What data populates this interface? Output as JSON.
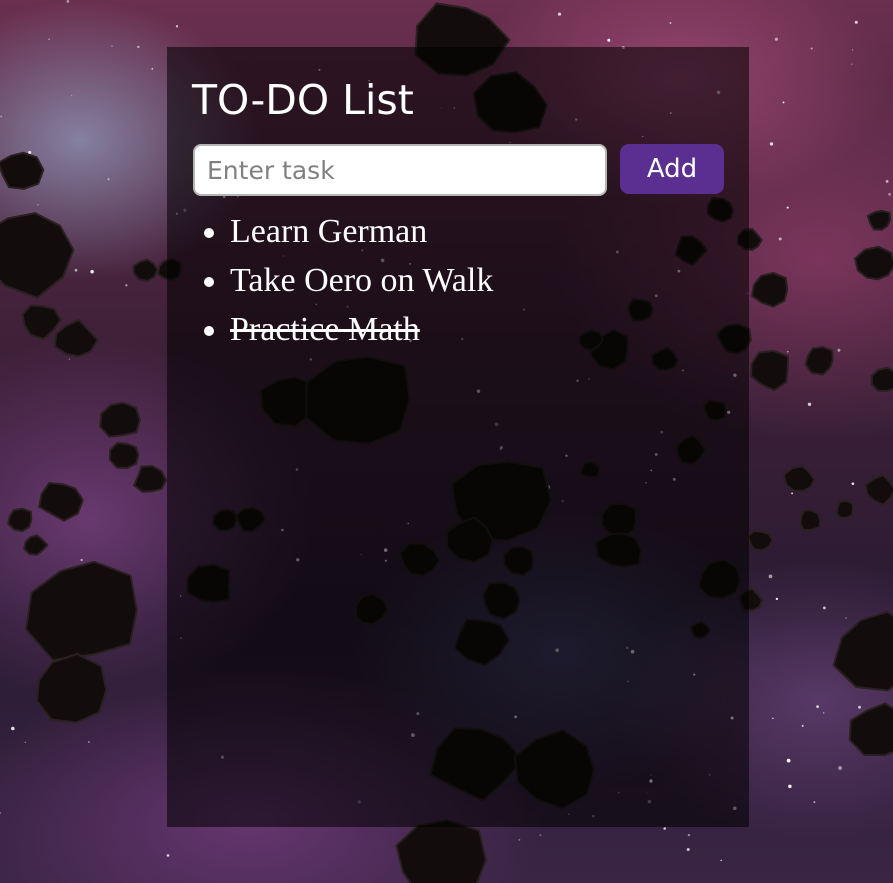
{
  "app": {
    "title": "TO-DO List"
  },
  "entry": {
    "placeholder": "Enter task",
    "value": "",
    "add_label": "Add"
  },
  "tasks": [
    {
      "text": "Learn German",
      "done": false
    },
    {
      "text": "Take Oero on Walk",
      "done": false
    },
    {
      "text": "Practice Math",
      "done": true
    }
  ],
  "colors": {
    "accent": "#5b2e91",
    "panel": "#000000",
    "text": "#ffffff"
  }
}
